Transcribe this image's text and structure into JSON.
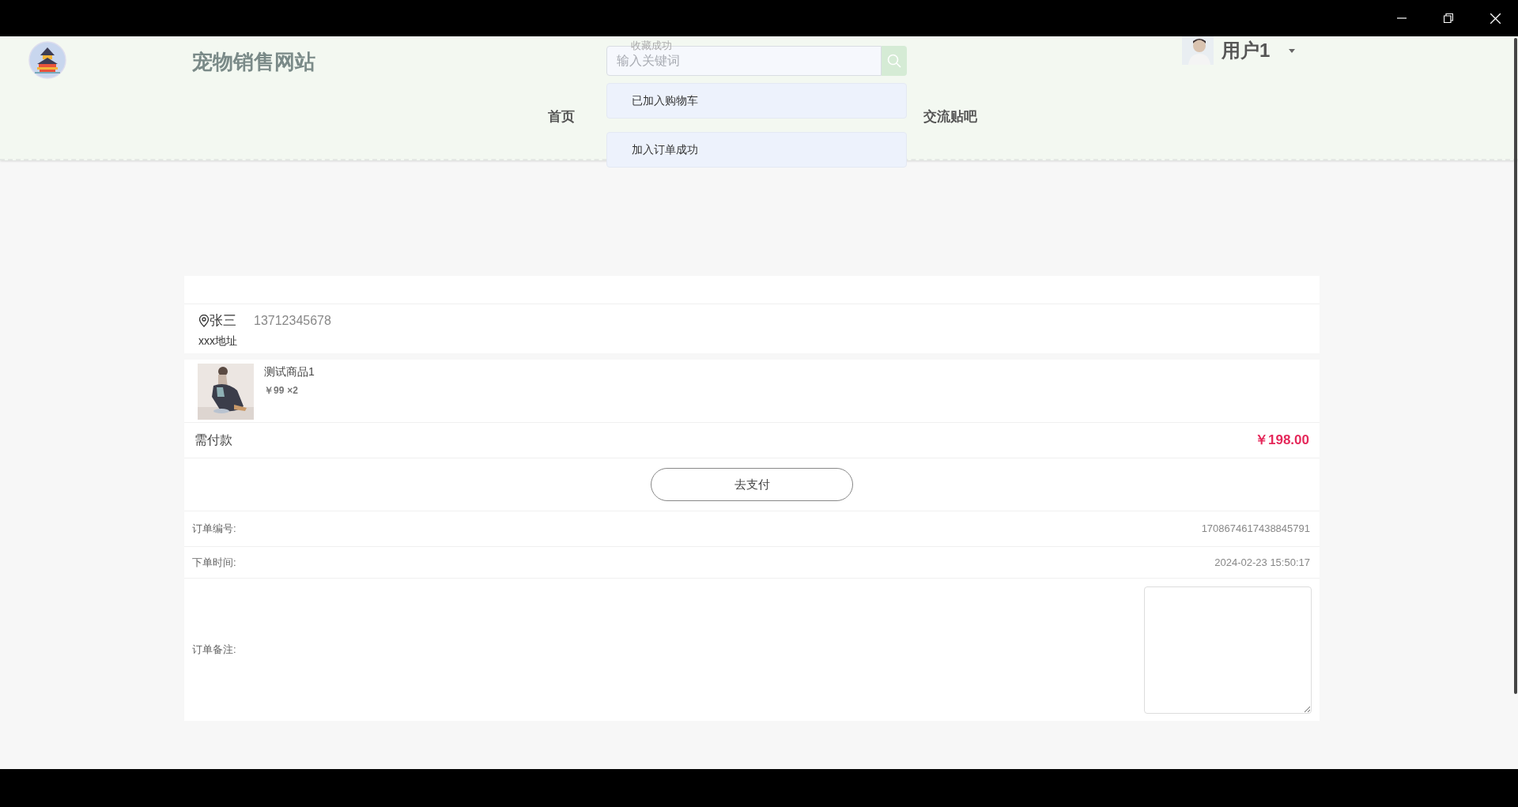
{
  "header": {
    "site_title": "宠物销售网站",
    "search": {
      "placeholder": "输入关键词"
    },
    "user": {
      "name": "用户1"
    },
    "nav": [
      {
        "label": "首页"
      },
      {
        "label": "交流贴吧"
      }
    ]
  },
  "toasts": [
    {
      "text": "收藏成功",
      "fading": true
    },
    {
      "text": "已加入购物车",
      "fading": false
    },
    {
      "text": "加入订单成功",
      "fading": false
    }
  ],
  "address": {
    "name": "张三",
    "phone": "13712345678",
    "address": "xxx地址"
  },
  "items": [
    {
      "name": "测试商品1",
      "price": "￥99",
      "quantity": "×2"
    }
  ],
  "payable": {
    "label": "需付款",
    "amount": "￥198.00"
  },
  "pay_button": "去支付",
  "details": [
    {
      "label": "订单编号:",
      "value": "1708674617438845791"
    },
    {
      "label": "下单时间:",
      "value": "2024-02-23 15:50:17"
    }
  ],
  "remark": {
    "label": "订单备注:"
  }
}
